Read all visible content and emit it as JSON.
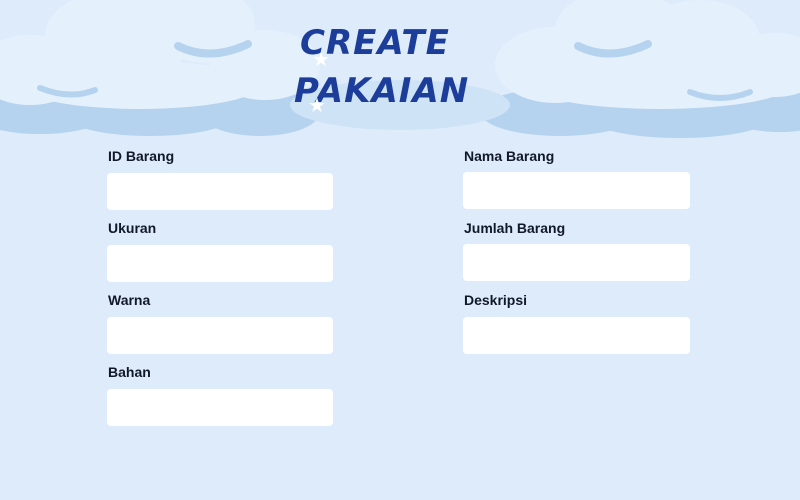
{
  "header": {
    "title_line1": "CREATE",
    "title_line2": "PAKAIAN"
  },
  "form": {
    "id_barang": {
      "label": "ID Barang",
      "value": "",
      "placeholder": ""
    },
    "nama_barang": {
      "label": "Nama Barang",
      "value": "",
      "placeholder": ""
    },
    "ukuran": {
      "label": "Ukuran",
      "value": "",
      "placeholder": ""
    },
    "jumlah_barang": {
      "label": "Jumlah Barang",
      "value": "",
      "placeholder": ""
    },
    "warna": {
      "label": "Warna",
      "value": "",
      "placeholder": ""
    },
    "deskripsi": {
      "label": "Deskripsi",
      "value": "",
      "placeholder": ""
    },
    "bahan": {
      "label": "Bahan",
      "value": "",
      "placeholder": ""
    }
  },
  "colors": {
    "background": "#deebfb",
    "cloud_front": "#e4f1fc",
    "cloud_shadow": "#b5d3ee",
    "title": "#1c3d9a",
    "input_bg": "#ffffff"
  }
}
